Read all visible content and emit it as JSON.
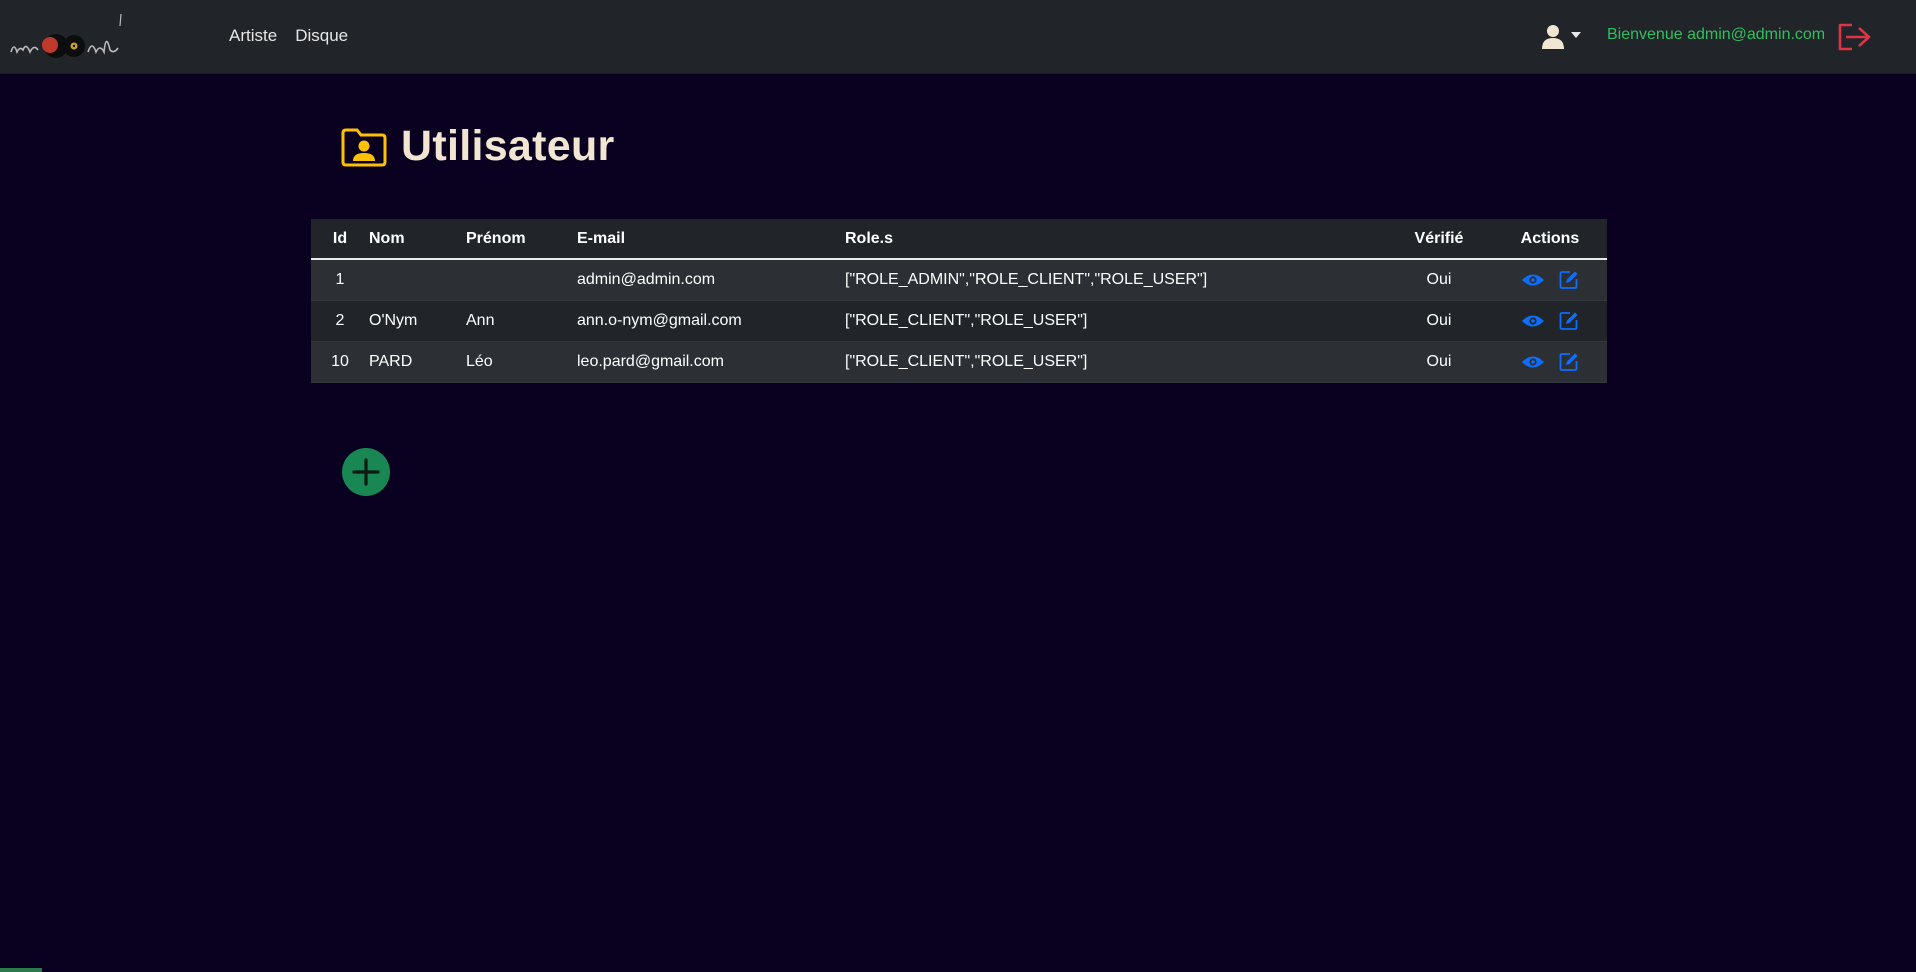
{
  "brand": {
    "logo_text": "record"
  },
  "nav": {
    "items": [
      {
        "label": "Artiste"
      },
      {
        "label": "Disque"
      }
    ]
  },
  "user_menu": {
    "icon": "user-icon",
    "welcome": "Bienvenue admin@admin.com",
    "logout_icon": "logout-icon"
  },
  "colors": {
    "navbar_bg": "#212529",
    "page_bg": "#0a0020",
    "welcome": "#2fbf5f",
    "logout": "#dc3545",
    "action": "#0d6efd",
    "add": "#198754",
    "title_icon": "#ffc107"
  },
  "page": {
    "title": "Utilisateur",
    "title_icon": "user-folder-icon"
  },
  "table": {
    "headers": {
      "id": "Id",
      "nom": "Nom",
      "prenom": "Prénom",
      "email": "E-mail",
      "roles": "Role.s",
      "verifie": "Vérifié",
      "actions": "Actions"
    },
    "rows": [
      {
        "id": "1",
        "nom": "",
        "prenom": "",
        "email": "admin@admin.com",
        "roles": "[\"ROLE_ADMIN\",\"ROLE_CLIENT\",\"ROLE_USER\"]",
        "verifie": "Oui"
      },
      {
        "id": "2",
        "nom": "O'Nym",
        "prenom": "Ann",
        "email": "ann.o-nym@gmail.com",
        "roles": "[\"ROLE_CLIENT\",\"ROLE_USER\"]",
        "verifie": "Oui"
      },
      {
        "id": "10",
        "nom": "PARD",
        "prenom": "Léo",
        "email": "leo.pard@gmail.com",
        "roles": "[\"ROLE_CLIENT\",\"ROLE_USER\"]",
        "verifie": "Oui"
      }
    ],
    "action_icons": [
      "eye-icon",
      "edit-icon"
    ]
  },
  "add_button": {
    "icon": "plus-icon"
  }
}
